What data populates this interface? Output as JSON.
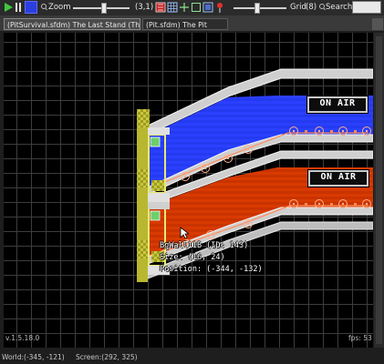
{
  "toolbar": {
    "zoom_label": "Zoom",
    "zoom_level": "(3,1)",
    "zoom_slider_value": 0.55,
    "grid_label": "Grid",
    "grid_value": "(8)",
    "grid_slider_value": 0.45,
    "search_label": "Search"
  },
  "tabs": [
    {
      "label": "(PitSurvival.sfdm) The Last Stand (The Pit)"
    },
    {
      "label": "(Pit.sfdm) The Pit"
    }
  ],
  "canvas": {
    "signs": [
      {
        "text": "ON AIR"
      },
      {
        "text": "ON AIR"
      }
    ],
    "tooltip": {
      "name": "BgWall11B (ID: 143)",
      "size": "Size: (16, 24)",
      "position": "Position: (-344, -132)"
    },
    "version": "v.1.5.18.0",
    "fps": "fps: 53"
  },
  "status": {
    "world": "World:(-345, -121)",
    "screen": "Screen:(292, 325)"
  },
  "colors": {
    "blue_lane": "#2b40ff",
    "red_lane": "#d83a00",
    "wall": "#d8d8d8",
    "pillar": "#c8c840"
  }
}
